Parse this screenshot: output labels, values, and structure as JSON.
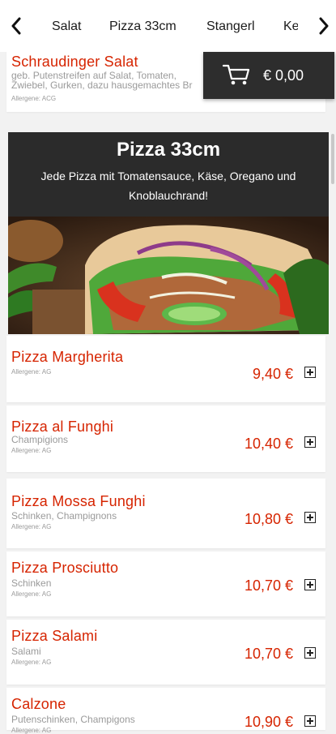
{
  "nav": {
    "tabs": [
      "Salat",
      "Pizza 33cm",
      "Stangerl",
      "Ke"
    ]
  },
  "cart": {
    "total": "€ 0,00"
  },
  "prev_item": {
    "name": "Schraudinger Salat",
    "desc": "geb. Putenstreifen auf Salat, Tomaten, Zwiebel, Gurken, dazu hausgemachtes Br",
    "allergen": "Allergene: ACG"
  },
  "category": {
    "title": "Pizza 33cm",
    "subtitle": "Jede Pizza mit Tomatensauce, Käse, Oregano und Knoblauchrand!"
  },
  "items": [
    {
      "name": "Pizza Margherita",
      "desc": "",
      "allergen": "Allergene: AG",
      "price": "9,40 €"
    },
    {
      "name": "Pizza al Funghi",
      "desc": "Champigions",
      "allergen": "Allergene: AG",
      "price": "10,40 €"
    },
    {
      "name": "Pizza Mossa Funghi",
      "desc": "Schinken, Champignons",
      "allergen": "Allergene: AG",
      "price": "10,80 €"
    },
    {
      "name": "Pizza Prosciutto",
      "desc": "Schinken",
      "allergen": "Allergene: AG",
      "price": "10,70 €"
    },
    {
      "name": "Pizza Salami",
      "desc": "Salami",
      "allergen": "Allergene: AG",
      "price": "10,70 €"
    },
    {
      "name": "Calzone",
      "desc": "Putenschinken, Champigons",
      "allergen": "Allergene: AG",
      "price": "10,90 €"
    }
  ],
  "colors": {
    "accent": "#d62400",
    "dark": "#2b2b2b",
    "background": "#f2f2f2"
  },
  "icons": {
    "nav_left": "chevron-left-icon",
    "nav_right": "chevron-right-icon",
    "cart": "cart-icon",
    "add": "plus-square-icon"
  }
}
